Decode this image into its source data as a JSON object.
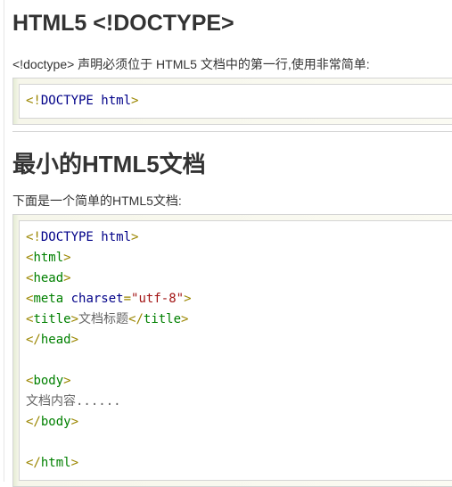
{
  "section1": {
    "title": "HTML5 <!DOCTYPE>",
    "description": "<!doctype> 声明必须位于 HTML5 文档中的第一行,使用非常简单:",
    "code": [
      [
        [
          "br",
          "<!"
        ],
        [
          "dt",
          "DOCTYPE html"
        ],
        [
          "br",
          ">"
        ]
      ]
    ]
  },
  "section2": {
    "title": "最小的HTML5文档",
    "description": "下面是一个简单的HTML5文档:",
    "code": [
      [
        [
          "br",
          "<!"
        ],
        [
          "dt",
          "DOCTYPE html"
        ],
        [
          "br",
          ">"
        ]
      ],
      [
        [
          "br",
          "<"
        ],
        [
          "tag",
          "html"
        ],
        [
          "br",
          ">"
        ]
      ],
      [
        [
          "br",
          "<"
        ],
        [
          "tag",
          "head"
        ],
        [
          "br",
          ">"
        ]
      ],
      [
        [
          "br",
          "<"
        ],
        [
          "tag",
          "meta "
        ],
        [
          "attr",
          "charset"
        ],
        [
          "eq",
          "="
        ],
        [
          "str",
          "\"utf-8\""
        ],
        [
          "br",
          ">"
        ]
      ],
      [
        [
          "br",
          "<"
        ],
        [
          "tag",
          "title"
        ],
        [
          "br",
          ">"
        ],
        [
          "txt",
          "文档标题"
        ],
        [
          "br",
          "</"
        ],
        [
          "tag",
          "title"
        ],
        [
          "br",
          ">"
        ]
      ],
      [
        [
          "br",
          "</"
        ],
        [
          "tag",
          "head"
        ],
        [
          "br",
          ">"
        ]
      ],
      [],
      [
        [
          "br",
          "<"
        ],
        [
          "tag",
          "body"
        ],
        [
          "br",
          ">"
        ]
      ],
      [
        [
          "txt",
          "文档内容......"
        ]
      ],
      [
        [
          "br",
          "</"
        ],
        [
          "tag",
          "body"
        ],
        [
          "br",
          ">"
        ]
      ],
      [],
      [
        [
          "br",
          "</"
        ],
        [
          "tag",
          "html"
        ],
        [
          "br",
          ">"
        ]
      ]
    ]
  }
}
